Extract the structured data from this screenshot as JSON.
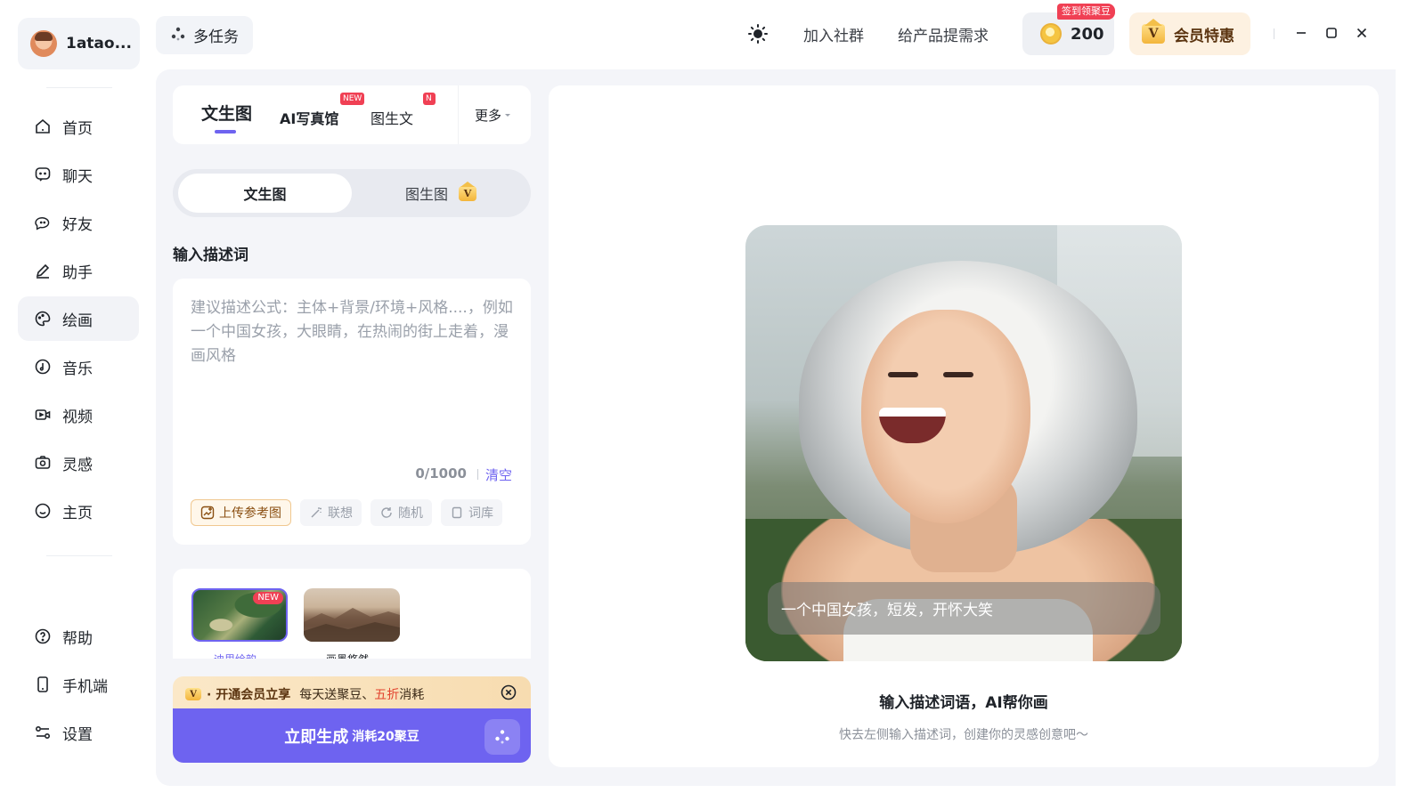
{
  "user": {
    "name": "1atao..."
  },
  "multitask": {
    "label": "多任务"
  },
  "nav": {
    "items": [
      {
        "label": "首页",
        "icon": "home-icon"
      },
      {
        "label": "聊天",
        "icon": "chat-icon"
      },
      {
        "label": "好友",
        "icon": "friends-icon"
      },
      {
        "label": "助手",
        "icon": "assistant-icon"
      },
      {
        "label": "绘画",
        "icon": "paint-icon",
        "active": true
      },
      {
        "label": "音乐",
        "icon": "music-icon"
      },
      {
        "label": "视频",
        "icon": "video-icon"
      },
      {
        "label": "灵感",
        "icon": "inspiration-icon"
      },
      {
        "label": "主页",
        "icon": "profile-icon"
      }
    ],
    "bottom": [
      {
        "label": "帮助",
        "icon": "help-icon"
      },
      {
        "label": "手机端",
        "icon": "mobile-icon"
      },
      {
        "label": "设置",
        "icon": "settings-icon"
      }
    ]
  },
  "topbar": {
    "join_community": "加入社群",
    "feedback": "给产品提需求",
    "coin_badge": "签到领聚豆",
    "coin_count": "200",
    "vip_label": "会员特惠",
    "vip_icon": "V"
  },
  "tabs": {
    "text2img": "文生图",
    "ai_photo": "AI写真馆",
    "img2text": "图生文",
    "new_badge": "NEW",
    "new_badge_cut": "N",
    "more": "更多"
  },
  "segment": {
    "text2img": "文生图",
    "img2img": "图生图"
  },
  "prompt": {
    "title": "输入描述词",
    "placeholder": "建议描述公式：主体+背景/环境+风格....，例如一个中国女孩，大眼睛，在热闹的街上走着，漫画风格",
    "value": "",
    "counter": "0/1000",
    "clear": "清空"
  },
  "tools": {
    "upload": "上传参考图",
    "associate": "联想",
    "random": "随机",
    "lexicon": "词库"
  },
  "styles": {
    "new_badge": "NEW",
    "items": [
      {
        "caption": "迪里绘韵"
      },
      {
        "caption": "画墨悠然"
      }
    ]
  },
  "vip_strip": {
    "lead": "· 开通会员立享",
    "text_a": "每天送聚豆、",
    "highlight": "五折",
    "text_b": "消耗"
  },
  "generate": {
    "label": "立即生成",
    "cost": "消耗20聚豆"
  },
  "canvas": {
    "caption": "一个中国女孩，短发，开怀大笑",
    "title": "输入描述词语，AI帮你画",
    "subtitle": "快去左侧输入描述词，创建你的灵感创意吧～"
  },
  "colors": {
    "accent": "#6e63f0",
    "vip_bg": "#fdf1e1",
    "badge_red": "#f04054"
  }
}
